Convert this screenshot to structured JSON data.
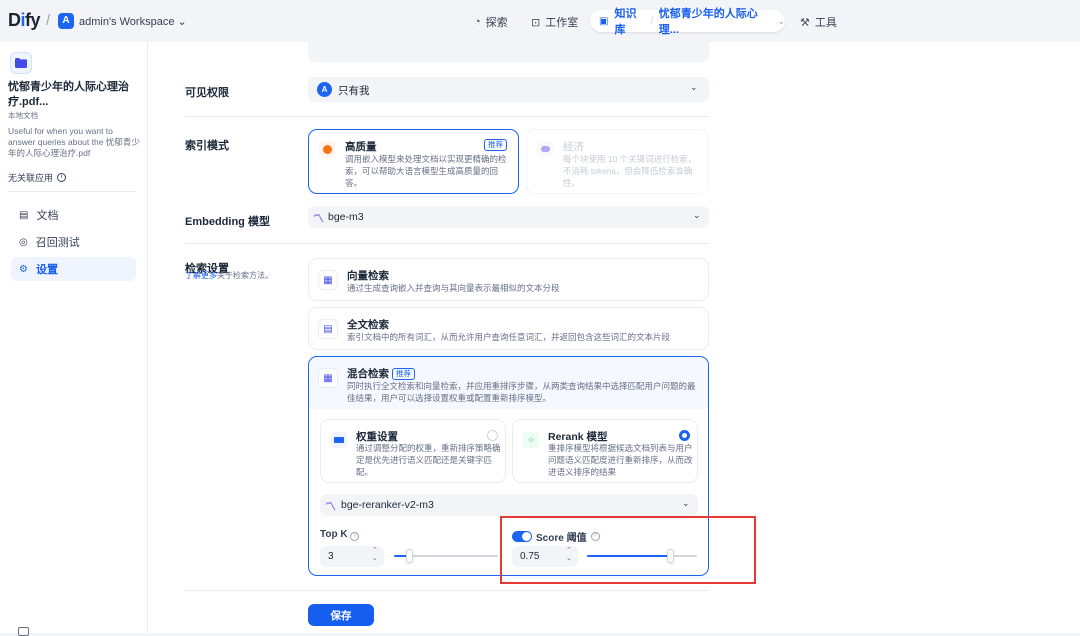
{
  "topbar": {
    "logo_text": "Dify",
    "workspace_avatar": "A",
    "workspace_name": "admin's Workspace",
    "nav": {
      "explore": "探索",
      "studio": "工作室",
      "knowledge": "知识库",
      "dataset_name": "忧郁青少年的人际心理...",
      "tools": "工具"
    }
  },
  "sidebar": {
    "dataset_title": "忧郁青少年的人际心理治疗.pdf...",
    "dataset_type": "本地文档",
    "description": "Useful for when you want to answer queries about the 忧郁青少年的人际心理治疗.pdf",
    "no_apps": "无关联应用",
    "items": [
      {
        "label": "文档",
        "icon": "doc-icon"
      },
      {
        "label": "召回测试",
        "icon": "target-icon"
      },
      {
        "label": "设置",
        "icon": "settings-icon"
      }
    ]
  },
  "settings": {
    "visibility": {
      "label": "可见权限",
      "avatar": "A",
      "value": "只有我"
    },
    "index_mode": {
      "label": "索引模式",
      "high_quality": {
        "title": "高质量",
        "badge": "推荐",
        "desc": "调用嵌入模型来处理文档以实现更精确的检索，可以帮助大语言模型生成高质量的回答。"
      },
      "economy": {
        "title": "经济",
        "desc": "每个块使用 10 个关键词进行检索，不消耗 tokens，但会降低检索准确性。"
      }
    },
    "embedding": {
      "label": "Embedding 模型",
      "value": "bge-m3"
    },
    "retrieval": {
      "label": "检索设置",
      "learn_more": "了解更多",
      "learn_more_suffix": "关于检索方法。",
      "vector": {
        "title": "向量检索",
        "desc": "通过生成查询嵌入并查询与其向量表示最相似的文本分段"
      },
      "fulltext": {
        "title": "全文检索",
        "desc": "索引文档中的所有词汇，从而允许用户查询任意词汇，并返回包含这些词汇的文本片段"
      },
      "hybrid": {
        "title": "混合检索",
        "badge": "推荐",
        "desc": "同时执行全文检索和向量检索，并应用重排序步骤，从两类查询结果中选择匹配用户问题的最佳结果，用户可以选择设置权重或配置重新排序模型。"
      },
      "weight": {
        "title": "权重设置",
        "desc": "通过调整分配的权重，重新排序策略确定是优先进行语义匹配还是关键字匹配。"
      },
      "rerank": {
        "title": "Rerank 模型",
        "desc": "重排序模型将根据候选文档列表与用户问题语义匹配度进行重新排序，从而改进语义排序的结果"
      },
      "rerank_model": "bge-reranker-v2-m3",
      "top_k": {
        "label": "Top K",
        "value": "3",
        "level": 0.14
      },
      "score": {
        "label": "Score 阈值",
        "value": "0.75",
        "level": 0.75,
        "enabled": true
      }
    },
    "save_label": "保存"
  },
  "colors": {
    "accent": "#1c64f2",
    "highlight_box": "#e53935"
  }
}
